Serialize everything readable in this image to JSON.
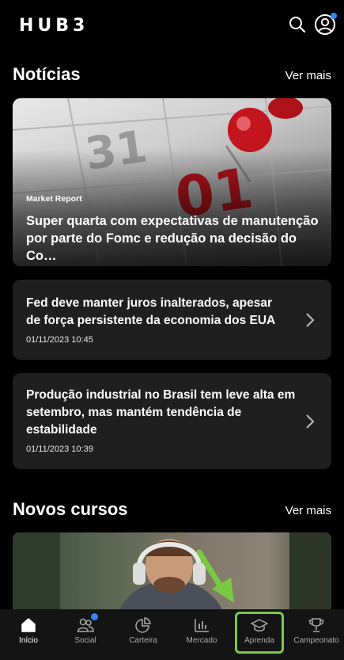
{
  "app": {
    "logo": "HUB3"
  },
  "header": {
    "search_icon": "search-icon",
    "profile_icon": "user-avatar-icon"
  },
  "news": {
    "title": "Notícias",
    "more_label": "Ver mais",
    "featured": {
      "tag": "Market Report",
      "title": "Super quarta com expectativas de manutenção por parte do Fomc e redução na decisão do Co…"
    },
    "items": [
      {
        "title": "Fed deve manter juros inalterados, apesar de força persistente da economia dos EUA",
        "date": "01/11/2023 10:45"
      },
      {
        "title": "Produção industrial no Brasil tem leve alta em setembro, mas mantém tendência de estabilidade",
        "date": "01/11/2023 10:39"
      }
    ]
  },
  "courses": {
    "title": "Novos cursos",
    "more_label": "Ver mais"
  },
  "bottom_nav": {
    "items": [
      {
        "label": "Início",
        "icon": "home-icon",
        "active": true
      },
      {
        "label": "Social",
        "icon": "people-icon",
        "badge": true
      },
      {
        "label": "Carteira",
        "icon": "pie-chart-icon"
      },
      {
        "label": "Mercado",
        "icon": "bar-chart-icon"
      },
      {
        "label": "Aprenda",
        "icon": "graduation-cap-icon"
      },
      {
        "label": "Campeonato",
        "icon": "trophy-icon"
      }
    ]
  },
  "colors": {
    "accent": "#3b82f6",
    "highlight": "#7ac943",
    "card": "#1f1f1f"
  }
}
